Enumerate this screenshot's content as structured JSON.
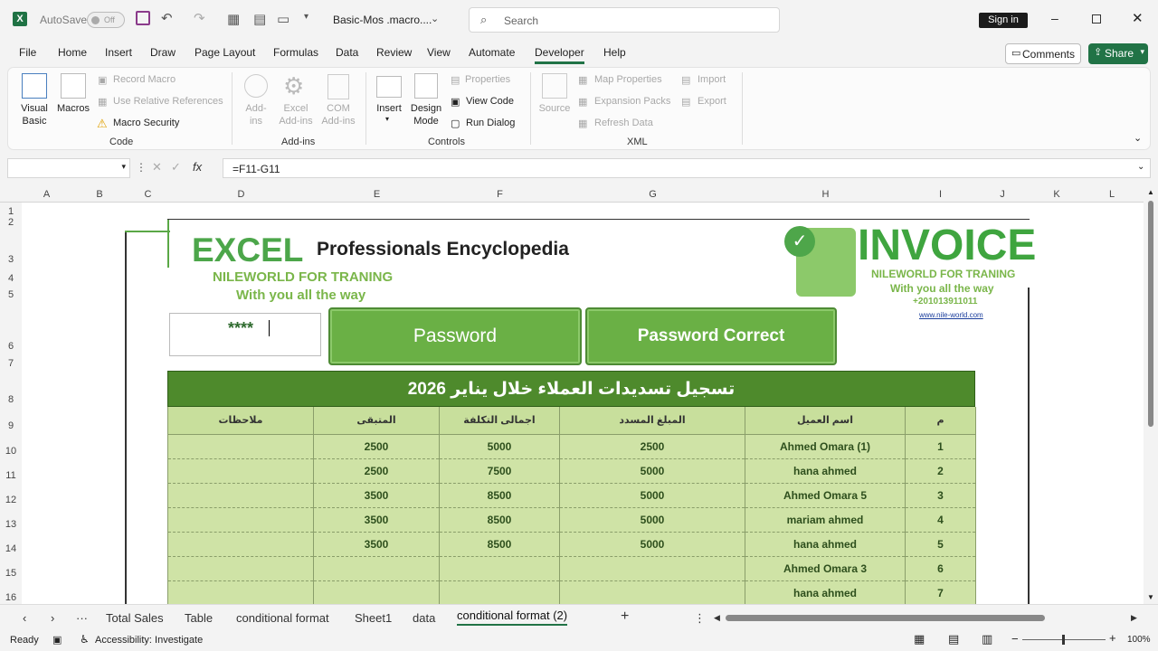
{
  "titlebar": {
    "autosave": "AutoSave",
    "autosave_state": "Off",
    "doc_title": "Basic-Mos .macro....",
    "search_placeholder": "Search",
    "signin": "Sign in"
  },
  "menu": {
    "tabs": [
      "File",
      "Home",
      "Insert",
      "Draw",
      "Page Layout",
      "Formulas",
      "Data",
      "Review",
      "View",
      "Automate",
      "Developer",
      "Help"
    ],
    "comments": "Comments",
    "share": "Share"
  },
  "ribbon": {
    "code": {
      "visual_basic": "Visual Basic",
      "macros": "Macros",
      "record_macro": "Record Macro",
      "relative_refs": "Use Relative References",
      "macro_security": "Macro Security",
      "label": "Code"
    },
    "addins": {
      "addins": "Add-ins",
      "excel_addins": "Excel Add-ins",
      "com_addins": "COM Add-ins",
      "label": "Add-ins"
    },
    "controls": {
      "insert": "Insert",
      "design_mode": "Design Mode",
      "properties": "Properties",
      "view_code": "View Code",
      "run_dialog": "Run Dialog",
      "label": "Controls"
    },
    "xml": {
      "source": "Source",
      "map_properties": "Map Properties",
      "expansion_packs": "Expansion Packs",
      "refresh_data": "Refresh Data",
      "import": "Import",
      "export": "Export",
      "label": "XML"
    }
  },
  "formula_bar": {
    "formula": "=F11-G11"
  },
  "columns": [
    "A",
    "B",
    "C",
    "D",
    "E",
    "F",
    "G",
    "H",
    "I",
    "J",
    "K",
    "L"
  ],
  "rows": [
    "1",
    "2",
    "3",
    "4",
    "5",
    "6",
    "7",
    "8",
    "9",
    "10",
    "11",
    "12",
    "13",
    "14",
    "15",
    "16"
  ],
  "invoice": {
    "excel": "EXCEL",
    "encyclopedia": "Professionals Encyclopedia",
    "org": "NILEWORLD FOR TRANING",
    "slogan": "With you all the way",
    "title": "INVOICE",
    "org2": "NILEWORLD FOR TRANING",
    "slogan2": "With you all the way",
    "phone": "+201013911011",
    "url": "www.nile-world.com",
    "password_value": "****",
    "password_btn": "Password",
    "password_correct_btn": "Password Correct",
    "table_title": "تسجيل تسديدات العملاء خلال يناير 2026",
    "headers": [
      "ملاحظات",
      "المتبقى",
      "اجمالى التكلفة",
      "المبلغ المسدد",
      "اسم العميل",
      "م"
    ],
    "rows": [
      [
        "",
        "2500",
        "5000",
        "2500",
        "Ahmed Omara (1)",
        "1"
      ],
      [
        "",
        "2500",
        "7500",
        "5000",
        "hana ahmed",
        "2"
      ],
      [
        "",
        "3500",
        "8500",
        "5000",
        "Ahmed Omara 5",
        "3"
      ],
      [
        "",
        "3500",
        "8500",
        "5000",
        "mariam ahmed",
        "4"
      ],
      [
        "",
        "3500",
        "8500",
        "5000",
        "hana ahmed",
        "5"
      ],
      [
        "",
        "",
        "",
        "",
        "Ahmed Omara 3",
        "6"
      ],
      [
        "",
        "",
        "",
        "",
        "hana ahmed",
        "7"
      ]
    ]
  },
  "sheets": {
    "tabs": [
      "Total Sales",
      "Table",
      "conditional format",
      "Sheet1",
      "data"
    ],
    "active": "conditional format (2)"
  },
  "status": {
    "ready": "Ready",
    "accessibility": "Accessibility: Investigate",
    "zoom": "100%"
  }
}
